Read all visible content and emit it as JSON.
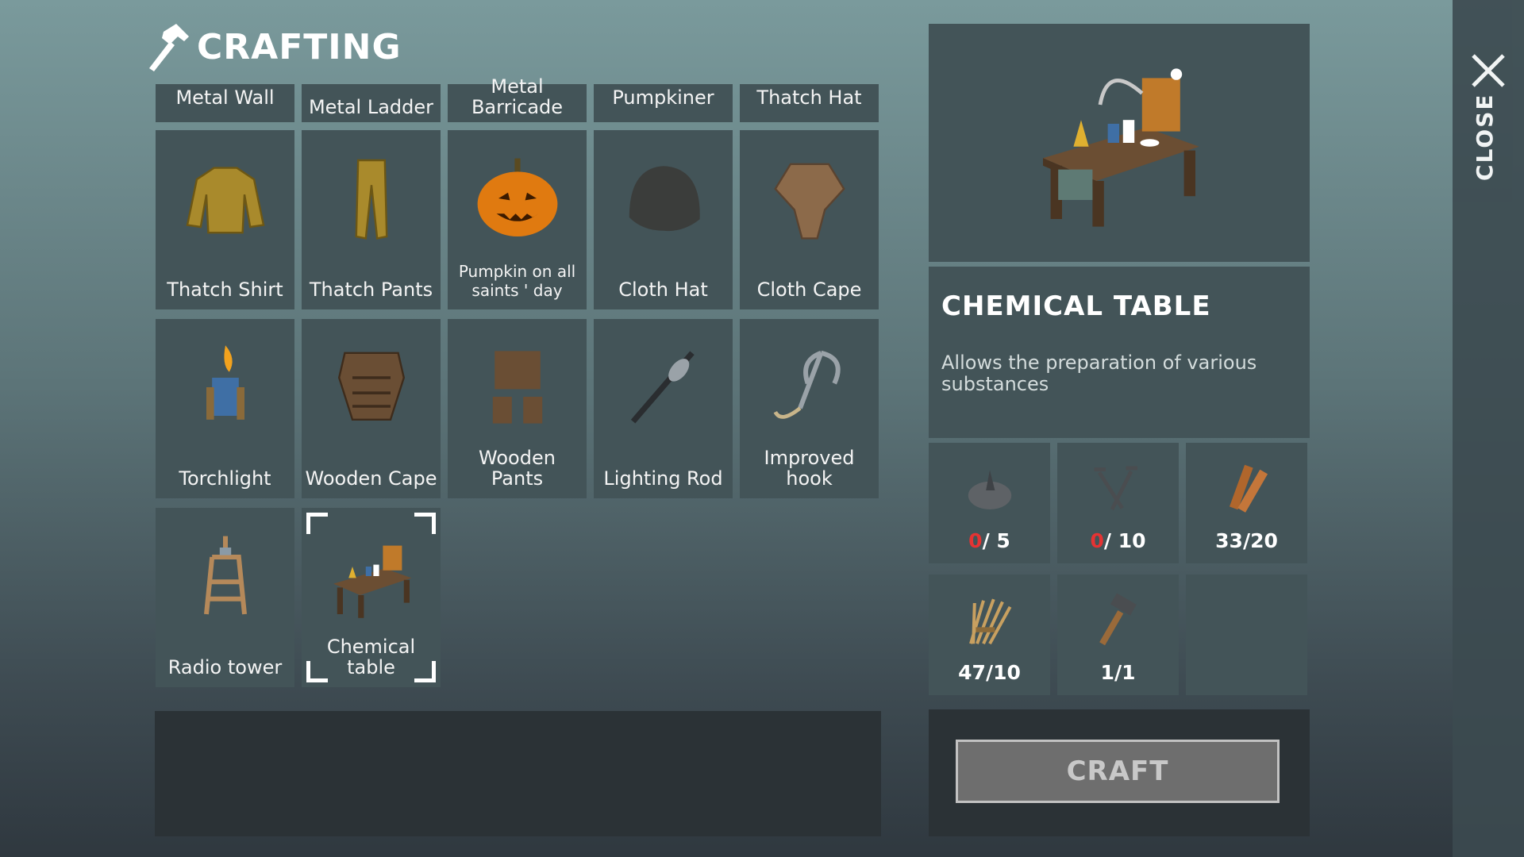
{
  "header": {
    "title": "CRAFTING"
  },
  "grid": {
    "top_row": [
      {
        "label": "Metal Wall",
        "icon": "metal-wall"
      },
      {
        "label": "Metal Ladder",
        "icon": "metal-ladder"
      },
      {
        "label": "Metal Barricade",
        "icon": "metal-barricade"
      },
      {
        "label": "Pumpkiner",
        "icon": "pumpkiner"
      },
      {
        "label": "Thatch Hat",
        "icon": "thatch-hat"
      }
    ],
    "rows": [
      [
        {
          "label": "Thatch Shirt",
          "icon": "thatch-shirt-icon"
        },
        {
          "label": "Thatch Pants",
          "icon": "thatch-pants-icon"
        },
        {
          "label": "Pumpkin on all saints ' day",
          "icon": "pumpkin-icon"
        },
        {
          "label": "Cloth Hat",
          "icon": "cloth-hat-icon"
        },
        {
          "label": "Cloth Cape",
          "icon": "cloth-cape-icon"
        }
      ],
      [
        {
          "label": "Torchlight",
          "icon": "torchlight-icon"
        },
        {
          "label": "Wooden Cape",
          "icon": "wooden-cape-icon"
        },
        {
          "label": "Wooden Pants",
          "icon": "wooden-pants-icon"
        },
        {
          "label": "Lighting Rod",
          "icon": "lighting-rod-icon"
        },
        {
          "label": "Improved hook",
          "icon": "improved-hook-icon"
        }
      ],
      [
        {
          "label": "Radio tower",
          "icon": "radio-tower-icon"
        },
        {
          "label": "Chemical table",
          "icon": "chemical-table-icon",
          "selected": true
        }
      ]
    ]
  },
  "detail": {
    "name": "CHEMICAL TABLE",
    "description": "Allows the preparation of various substances",
    "requirements": [
      {
        "icon": "stone-bowl-icon",
        "have": "0",
        "need": "/ 5",
        "insufficient": true
      },
      {
        "icon": "nails-icon",
        "have": "0",
        "need": "/ 10",
        "insufficient": true
      },
      {
        "icon": "planks-icon",
        "have": "33",
        "need": "/20",
        "insufficient": false
      },
      {
        "icon": "fiber-icon",
        "have": "47",
        "need": "/10",
        "insufficient": false
      },
      {
        "icon": "hammer-icon",
        "have": "1",
        "need": "/1",
        "insufficient": false
      }
    ],
    "craft_label": "CRAFT"
  },
  "side": {
    "close_label": "CLOSE"
  },
  "colors": {
    "bad": "#e53333",
    "tile": "#435458",
    "panel": "#2b3236"
  }
}
